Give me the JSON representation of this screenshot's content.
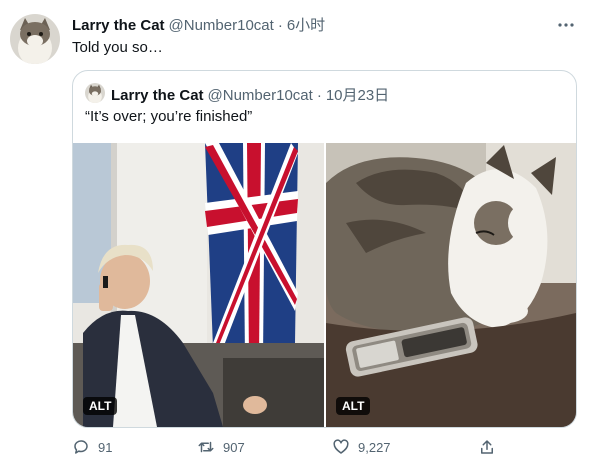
{
  "tweet": {
    "author_name": "Larry the Cat",
    "handle": "@Number10cat",
    "separator": "·",
    "time": "6小时",
    "text": "Told you so…",
    "avatar_icon": "cat-avatar-icon",
    "more_icon": "more-icon"
  },
  "quote": {
    "author_name": "Larry the Cat",
    "handle": "@Number10cat",
    "separator": "·",
    "date": "10月23日",
    "text": "“It’s over; you’re finished”",
    "images": [
      {
        "name": "boris-phone-photo",
        "alt_label": "ALT"
      },
      {
        "name": "cat-phone-photo",
        "alt_label": "ALT"
      }
    ]
  },
  "actions": {
    "reply_count": "91",
    "retweet_count": "907",
    "like_count": "9,227",
    "icons": [
      "reply-icon",
      "retweet-icon",
      "like-icon",
      "share-icon"
    ]
  },
  "colors": {
    "text": "#0f1419",
    "muted": "#536471",
    "border": "#cfd9de",
    "alt_badge_bg": "#000000"
  }
}
